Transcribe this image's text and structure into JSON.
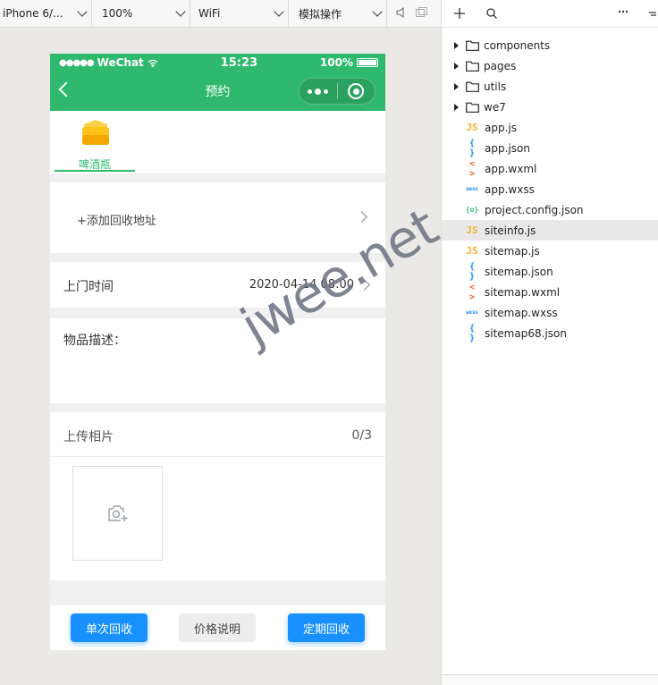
{
  "toolbar": {
    "device": "iPhone 6/...",
    "zoom": "100%",
    "network": "WiFi",
    "mode": "模拟操作"
  },
  "status": {
    "carrier": "WeChat",
    "time": "15:23",
    "battery": "100%"
  },
  "nav": {
    "title": "预约"
  },
  "category": {
    "label": "啤酒瓶"
  },
  "address": {
    "placeholder": "+添加回收地址"
  },
  "visit": {
    "label": "上门时间",
    "value": "2020-04-14 08:00"
  },
  "description": {
    "label": "物品描述："
  },
  "upload": {
    "label": "上传相片",
    "count": "0/3"
  },
  "actions": {
    "single": "单次回收",
    "price": "价格说明",
    "periodic": "定期回收"
  },
  "watermark": "jwee.net",
  "files": {
    "folders": [
      "components",
      "pages",
      "utils",
      "we7"
    ],
    "items": [
      {
        "name": "app.js",
        "type": "js",
        "badge": "JS"
      },
      {
        "name": "app.json",
        "type": "json",
        "badge": "{ }"
      },
      {
        "name": "app.wxml",
        "type": "wxml",
        "badge": "< >"
      },
      {
        "name": "app.wxss",
        "type": "wxss",
        "badge": "wxss"
      },
      {
        "name": "project.config.json",
        "type": "cfg",
        "badge": "{o}"
      },
      {
        "name": "siteinfo.js",
        "type": "js",
        "badge": "JS"
      },
      {
        "name": "sitemap.js",
        "type": "js",
        "badge": "JS"
      },
      {
        "name": "sitemap.json",
        "type": "json",
        "badge": "{ }"
      },
      {
        "name": "sitemap.wxml",
        "type": "wxml",
        "badge": "< >"
      },
      {
        "name": "sitemap.wxss",
        "type": "wxss",
        "badge": "wxss"
      },
      {
        "name": "sitemap68.json",
        "type": "json",
        "badge": "{ }"
      }
    ],
    "selected": "siteinfo.js"
  },
  "colors": {
    "brand_green": "#2fb96e",
    "primary_blue": "#1890ff"
  }
}
